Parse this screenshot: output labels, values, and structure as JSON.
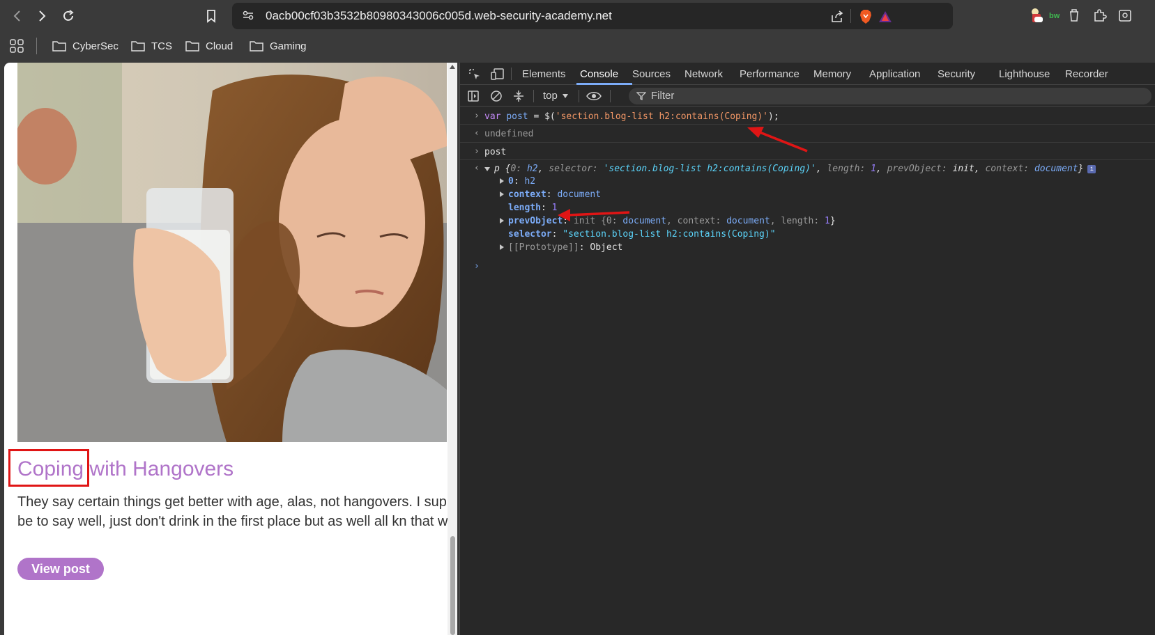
{
  "browser": {
    "url": "0acb00cf03b3532b80980343006c005d.web-security-academy.net",
    "bookmarks": [
      "CyberSec",
      "TCS",
      "Cloud",
      "Gaming"
    ]
  },
  "page": {
    "post_title_highlight": "Coping",
    "post_title_rest": " with Hangovers",
    "summary": "They say certain things get better with age, alas, not hangovers. I sup would be to say well, just don't drink in the first place but as well all kn that we...",
    "view_button": "View post"
  },
  "devtools": {
    "tabs": [
      "Elements",
      "Console",
      "Sources",
      "Network",
      "Performance",
      "Memory",
      "Application",
      "Security",
      "Lighthouse",
      "Recorder"
    ],
    "active_tab": "Console",
    "context": "top",
    "filter_placeholder": "Filter",
    "console": {
      "input1_kw": "var",
      "input1_var": "post",
      "input1_eq": " = $(",
      "input1_str": "'section.blog-list h2:contains(Coping)'",
      "input1_end": ");",
      "output1": "undefined",
      "input2": "post",
      "obj_head_p": "p",
      "obj_head_0k": "0",
      "obj_head_0v": "h2",
      "obj_head_selk": "selector",
      "obj_head_selv": "'section.blog-list h2:contains(Coping)'",
      "obj_head_lenk": "length",
      "obj_head_lenv": "1",
      "obj_head_prevk": "prevObject",
      "obj_head_prevv": "init",
      "obj_head_ctxk": "context",
      "obj_head_ctxv": "document",
      "row0_k": "0",
      "row0_v": "h2",
      "row_context_k": "context",
      "row_context_v": "document",
      "row_length_k": "length",
      "row_length_v": "1",
      "row_prev_k": "prevObject",
      "row_prev_v1": "init {0: ",
      "row_prev_v2": "document",
      "row_prev_v3": ", context: ",
      "row_prev_v4": "document",
      "row_prev_v5": ", length: ",
      "row_prev_v6": "1",
      "row_prev_v7": "}",
      "row_sel_k": "selector",
      "row_sel_v": "\"section.blog-list h2:contains(Coping)\"",
      "row_proto_k": "[[Prototype]]",
      "row_proto_v": "Object"
    }
  },
  "colors": {
    "accent_purple": "#b074c9",
    "annotation_red": "#e01515",
    "devtools_bg": "#282828"
  }
}
